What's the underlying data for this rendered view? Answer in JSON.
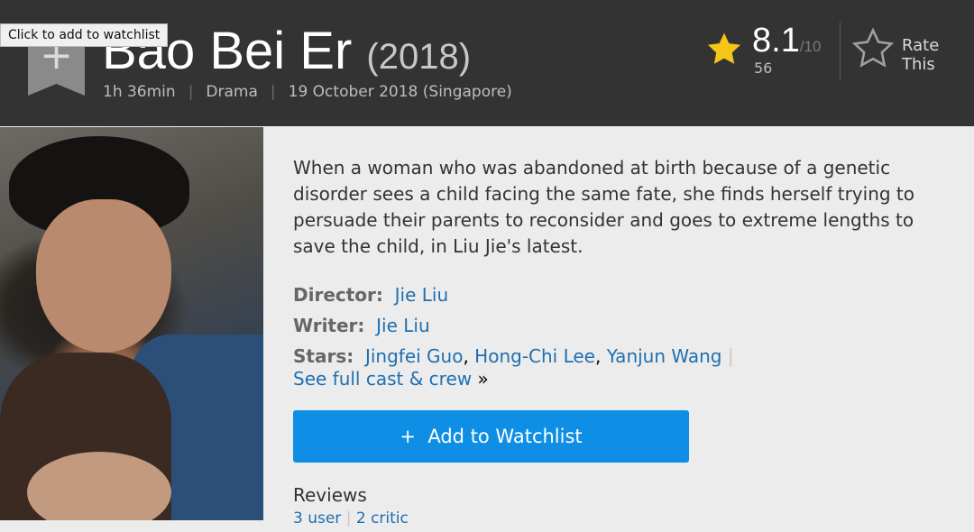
{
  "tooltip": "Click to add to watchlist",
  "title": "Bao Bei Er",
  "year": "(2018)",
  "subtext": {
    "runtime": "1h 36min",
    "genre": "Drama",
    "release": "19 October 2018 (Singapore)",
    "separator": "|"
  },
  "rating": {
    "value": "8.1",
    "best": "/10",
    "count": "56",
    "rate_label_1": "Rate",
    "rate_label_2": "This"
  },
  "plot": "When a woman who was abandoned at birth because of a genetic disorder sees a child facing the same fate, she finds herself trying to persuade their parents to reconsider and goes to extreme lengths to save the child, in Liu Jie's latest.",
  "credits": {
    "director_label": "Director:",
    "director": "Jie Liu",
    "writer_label": "Writer:",
    "writer": "Jie Liu",
    "stars_label": "Stars:",
    "stars": [
      "Jingfei Guo",
      "Hong-Chi Lee",
      "Yanjun Wang"
    ],
    "comma": ",",
    "separator": "|",
    "full_cast": "See full cast & crew",
    "full_cast_arrow": "»"
  },
  "watchlist_button": {
    "icon": "+",
    "label": "Add to Watchlist"
  },
  "reviews": {
    "title": "Reviews",
    "user": "3 user",
    "separator": "|",
    "critic": "2 critic"
  },
  "icons": {
    "ribbon": "watchlist-ribbon-icon",
    "star": "star-filled-icon",
    "rate": "star-outline-icon"
  },
  "colors": {
    "header_bg": "#333333",
    "star_gold": "#f5c518",
    "link_blue": "#1f6fb2",
    "button_blue": "#0f8ee6"
  }
}
